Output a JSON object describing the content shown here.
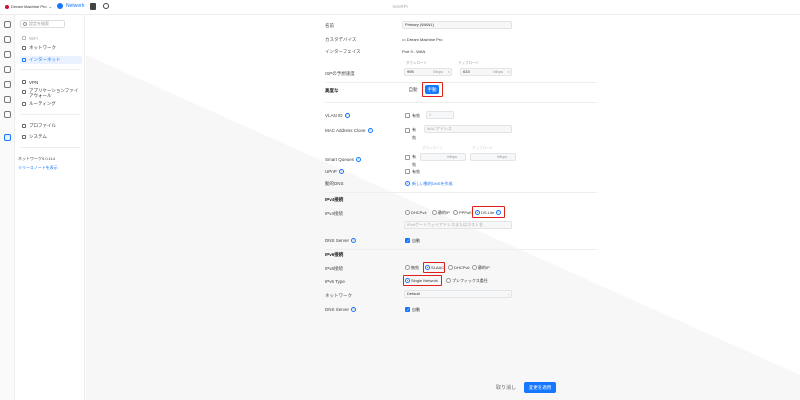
{
  "topbar": {
    "console_name": "Dream Machine Pro",
    "app_name": "Network",
    "page_title": "SenRPi"
  },
  "nav": {
    "search_placeholder": "設定を検索",
    "collapse": "‹",
    "items": [
      {
        "label": "WiFi"
      },
      {
        "label": "ネットワーク"
      },
      {
        "label": "インターネット"
      },
      {
        "label": "VPN"
      },
      {
        "label": "アプリケーションファイアウォール"
      },
      {
        "label": "ルーティング"
      },
      {
        "label": "プロファイル"
      },
      {
        "label": "システム"
      }
    ],
    "footer_title": "ネットワーク9.0.114",
    "footer_link": "リリースノートを表示"
  },
  "form": {
    "name_label": "名前",
    "name_value": "Primary (WAN1)",
    "custom_device_label": "カスタデバイス",
    "custom_device_value": "Dream Machine Pro",
    "interface_label": "インターフェイス",
    "interface_value": "Port 9 - WAN",
    "download_label": "ダウンロード",
    "upload_label": "アップロード",
    "isp_speed_label": "ISPの予想速度",
    "download_value": "995",
    "upload_value": "633",
    "unit_mbps": "Mbps",
    "advanced_label": "高度な",
    "advanced_auto": "自動",
    "advanced_manual": "手動",
    "vlan_label": "VLAN ID",
    "vlan_enabled": "有効",
    "vlan_value": "2",
    "mac_clone_label": "MAC Address Clone",
    "mac_clone_check": "有効",
    "mac_placeholder": "MACアドレス",
    "smart_queues_label": "Smart Queues",
    "smart_queues_check": "有効",
    "upnp_label": "UPnP",
    "upnp_check": "有効",
    "dyndns_label": "動的DNS",
    "dyndns_link": "新しい動的DNSを作成",
    "ipv4_section": "IPv4接続",
    "ipv4_type_label": "IPv4接続",
    "ipv4_options": [
      "DHCPv4",
      "静的IP",
      "PPPoE",
      "DS-Lite"
    ],
    "ipv4_gateway_placeholder": "IPv6ゲートウェイアドレスまたはホスト名",
    "dns_server_label": "DNS Server",
    "dns_auto": "自動",
    "ipv6_section": "IPv6接続",
    "ipv6_type_label": "IPv6接続",
    "ipv6_options": [
      "無効",
      "SLAAC",
      "DHCPv6",
      "静的IP"
    ],
    "ipv6_type2_label": "IPv6 Type",
    "ipv6_type2_options": [
      "Single Network",
      "プレフィックス委任"
    ],
    "network_label": "ネットワーク",
    "network_value": "Default",
    "dns_server2_label": "DNS Server",
    "dns_auto2": "自動"
  },
  "footer": {
    "cancel": "取り消し",
    "apply": "変更を適用"
  },
  "colors": {
    "accent": "#1677ff",
    "highlight": "#e0211b"
  }
}
